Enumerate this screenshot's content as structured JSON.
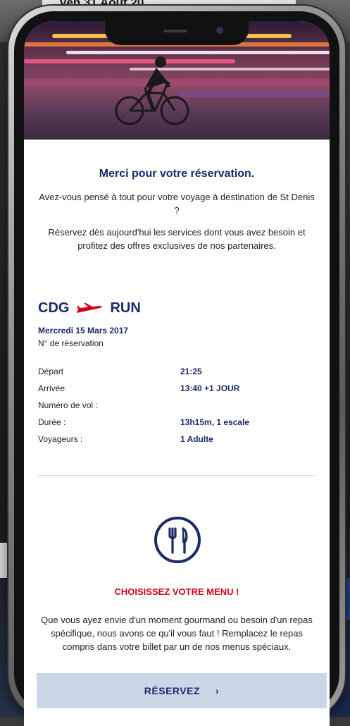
{
  "background": {
    "date_text": "ven 31 Août 20"
  },
  "email": {
    "title": "Merci pour votre réservation.",
    "intro": "Avez-vous pensé à tout pour votre voyage à destination de St Denis ?",
    "cta_text": "Réservez dès aujourd'hui les services dont vous avez besoin et profitez des offres exclusives de nos partenaires."
  },
  "flight": {
    "origin": "CDG",
    "destination": "RUN",
    "date": "Mercredi 15 Mars 2017",
    "reservation_label": "N° de réservation",
    "details": [
      {
        "label": "Départ",
        "value": "21:25"
      },
      {
        "label": "Arrivée",
        "value": "13:40 +1 JOUR"
      },
      {
        "label": "Numéro de vol :",
        "value": ""
      },
      {
        "label": "Durée :",
        "value": "13h15m, 1 escale"
      },
      {
        "label": "Voyageurs :",
        "value": "1 Adulte"
      }
    ]
  },
  "menu": {
    "icon": "fork-knife-icon",
    "title": "CHOISISSEZ VOTRE MENU !",
    "description": "Que vous ayez envie d'un moment gourmand ou besoin d'un repas spécifique, nous avons ce qu'il vous faut ! Remplacez le repas compris dans votre billet par un de nos menus spéciaux.",
    "button_label": "RÉSERVEZ",
    "button_arrow": "›"
  },
  "colors": {
    "brand_blue": "#1c2a6b",
    "accent_red": "#d0021b",
    "button_bg": "#cbd6e6"
  }
}
